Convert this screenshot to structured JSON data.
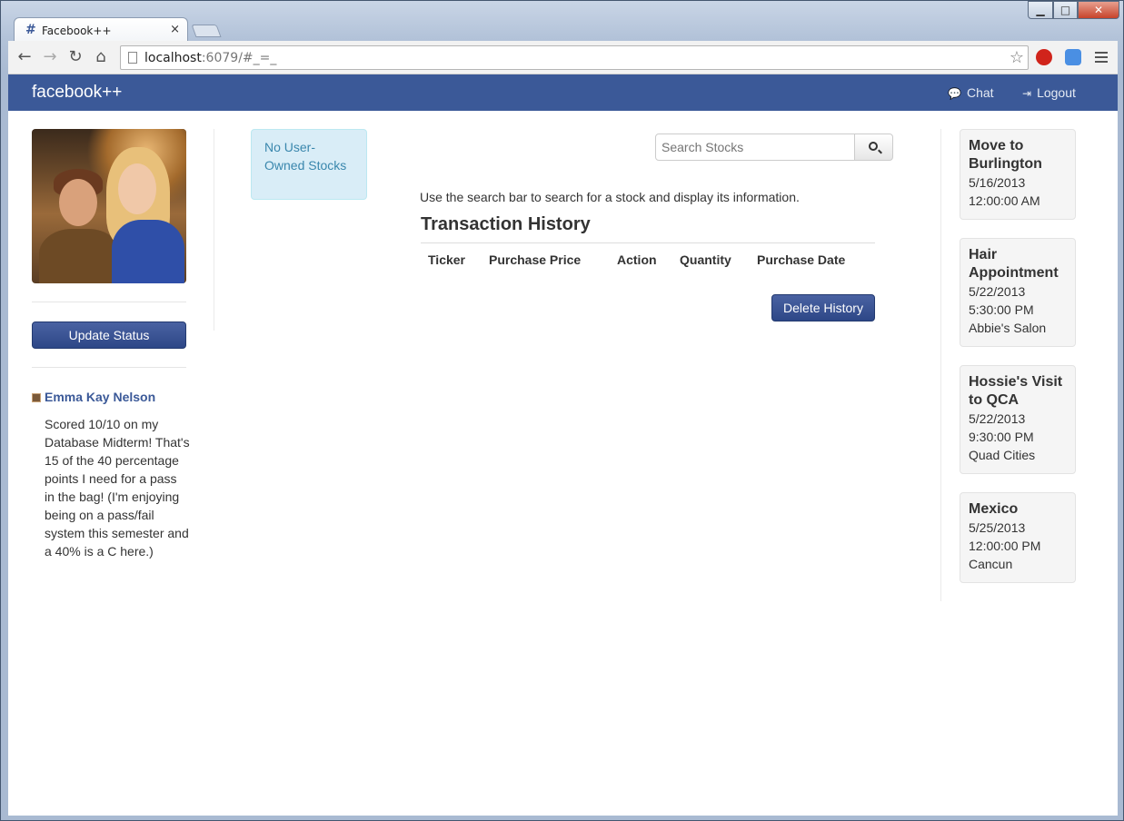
{
  "browser": {
    "tab_title": "Facebook++",
    "tab_close": "×",
    "url_host": "localhost",
    "url_rest": ":6079/#_=_",
    "window_controls": {
      "minimize": "▁",
      "maximize": "□",
      "close": "✕"
    }
  },
  "navbar": {
    "brand": "facebook++",
    "links": [
      {
        "label": "Chat",
        "icon": "chat-icon"
      },
      {
        "label": "Logout",
        "icon": "logout-icon"
      }
    ]
  },
  "sidebar": {
    "update_status_label": "Update Status",
    "status": {
      "author": "Emma Kay Nelson",
      "text": "Scored 10/10 on my Database Midterm! That's 15 of the 40 percentage points I need for a pass in the bag! (I'm enjoying being on a pass/fail system this semester and a 40% is a C here.)"
    }
  },
  "stocks": {
    "owned_alert": "No User-Owned Stocks",
    "search_placeholder": "Search Stocks",
    "instructions": "Use the search bar to search for a stock and display its information.",
    "history_title": "Transaction History",
    "columns": [
      "Ticker",
      "Purchase Price",
      "Action",
      "Quantity",
      "Purchase Date"
    ],
    "rows": [],
    "delete_label": "Delete History"
  },
  "events": [
    {
      "title": "Move to Burlington",
      "date": "5/16/2013",
      "time": "12:00:00 AM",
      "location": ""
    },
    {
      "title": "Hair Appointment",
      "date": "5/22/2013",
      "time": "5:30:00 PM",
      "location": "Abbie's Salon"
    },
    {
      "title": "Hossie's Visit to QCA",
      "date": "5/22/2013",
      "time": "9:30:00 PM",
      "location": "Quad Cities"
    },
    {
      "title": "Mexico",
      "date": "5/25/2013",
      "time": "12:00:00 PM",
      "location": "Cancun"
    }
  ],
  "colors": {
    "brand": "#3b5998",
    "info_bg": "#d9edf7",
    "info_text": "#3a87ad"
  }
}
